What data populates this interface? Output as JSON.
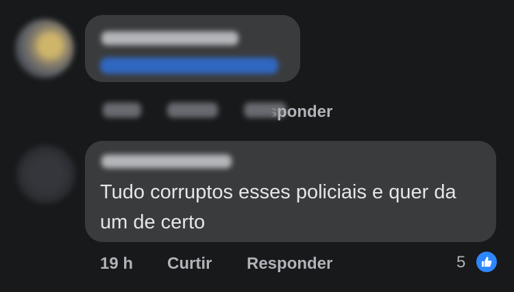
{
  "comment1": {
    "actions": {
      "reply_label": "Responder"
    }
  },
  "comment2": {
    "text": "Tudo corruptos esses policiais e quer da um de certo",
    "time": "19 h",
    "actions": {
      "like_label": "Curtir",
      "reply_label": "Responder"
    },
    "reaction_count": "5",
    "reaction_icon": "like-icon"
  },
  "colors": {
    "background": "#18191b",
    "bubble": "#3a3b3c",
    "accent": "#2d88ff",
    "meta_text": "#b0b3b8"
  }
}
